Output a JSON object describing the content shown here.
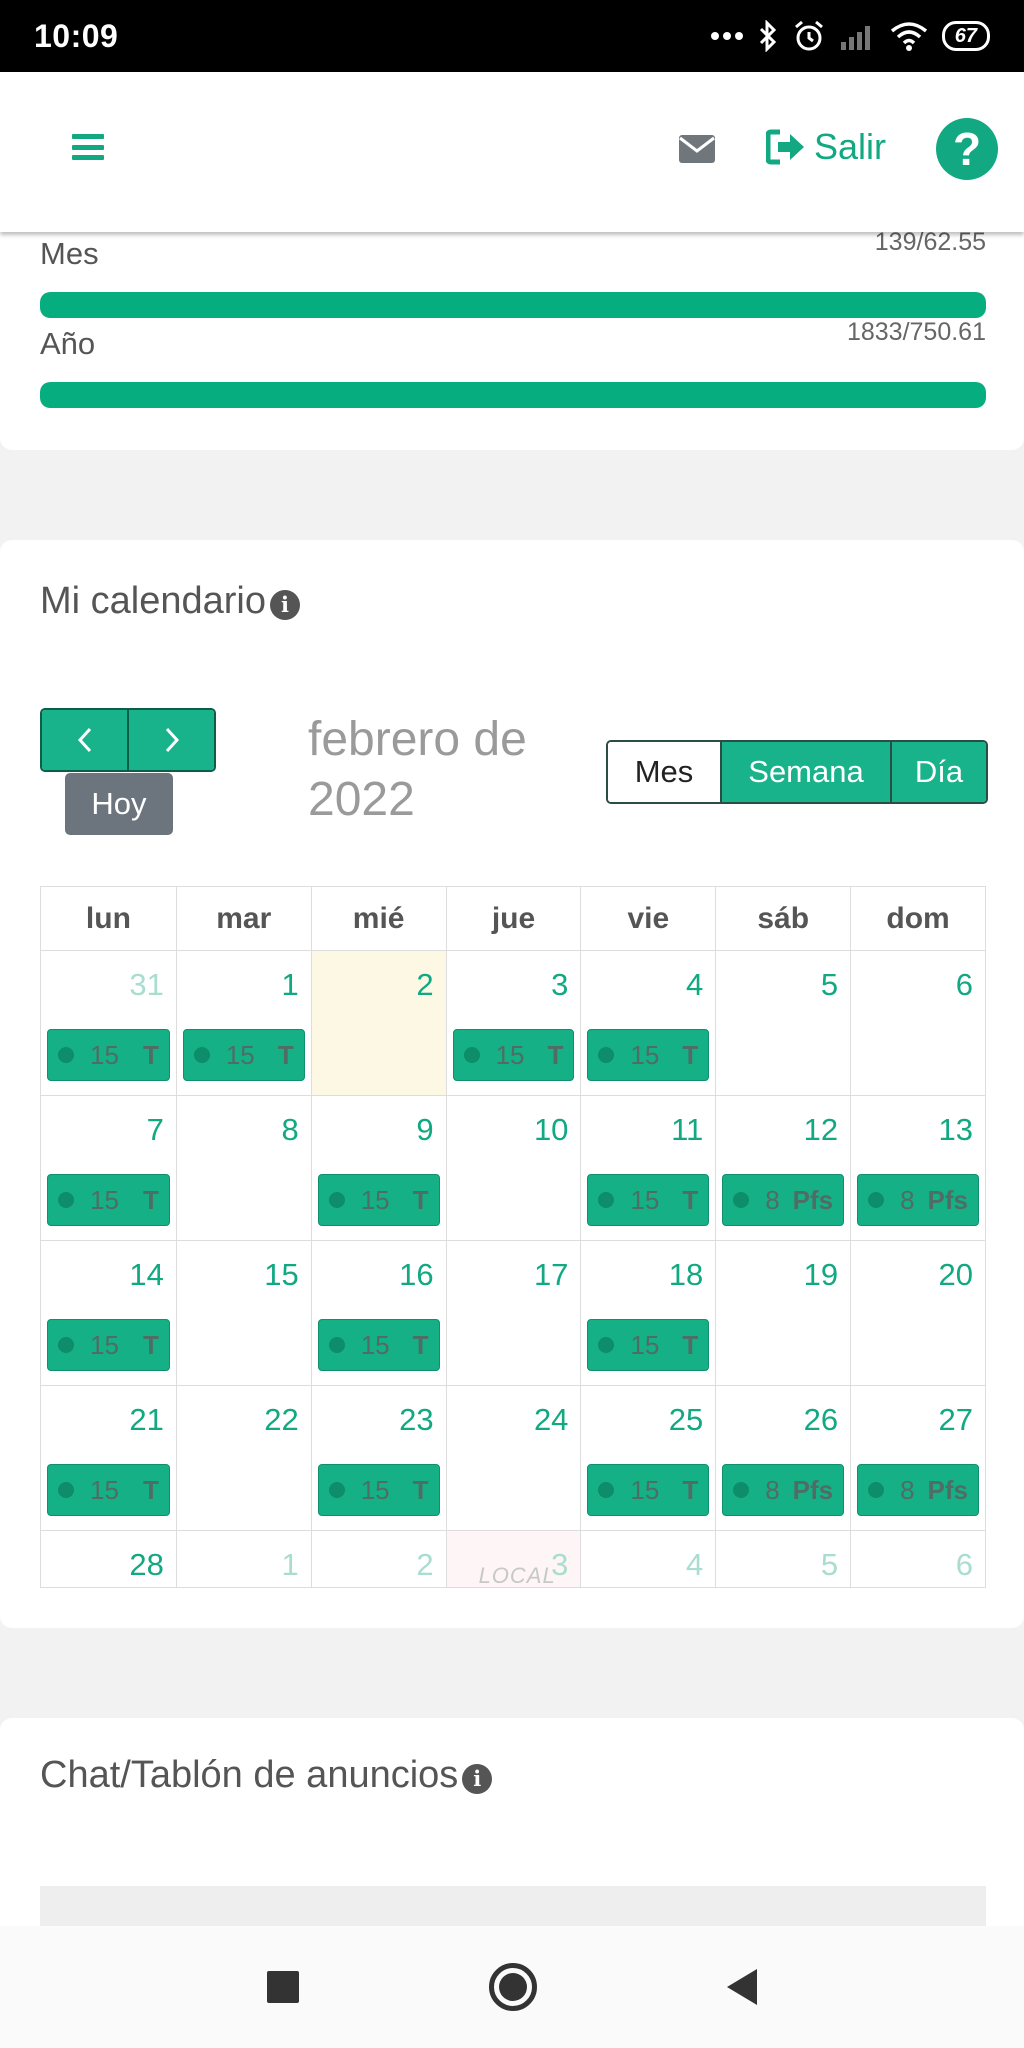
{
  "status_bar": {
    "time": "10:09",
    "battery": "67"
  },
  "header": {
    "logout_label": "Salir",
    "help_symbol": "?"
  },
  "stats": [
    {
      "label": "Mes",
      "value": "139/62.55",
      "progress": 1.0
    },
    {
      "label": "Año",
      "value": "1833/750.61",
      "progress": 1.0
    }
  ],
  "calendar": {
    "title": "Mi calendario",
    "info_symbol": "i",
    "prev_symbol": "‹",
    "next_symbol": "›",
    "today_label": "Hoy",
    "month_title": "febrero de 2022",
    "views": [
      "Mes",
      "Semana",
      "Día"
    ],
    "weekdays": [
      "lun",
      "mar",
      "mié",
      "jue",
      "vie",
      "sáb",
      "dom"
    ],
    "weeks": [
      [
        {
          "day": "31",
          "other": true,
          "event": {
            "num": "15",
            "code": "T"
          }
        },
        {
          "day": "1",
          "event": {
            "num": "15",
            "code": "T"
          }
        },
        {
          "day": "2",
          "today": true
        },
        {
          "day": "3",
          "event": {
            "num": "15",
            "code": "T"
          }
        },
        {
          "day": "4",
          "event": {
            "num": "15",
            "code": "T"
          }
        },
        {
          "day": "5"
        },
        {
          "day": "6"
        }
      ],
      [
        {
          "day": "7",
          "event": {
            "num": "15",
            "code": "T"
          }
        },
        {
          "day": "8"
        },
        {
          "day": "9",
          "event": {
            "num": "15",
            "code": "T"
          }
        },
        {
          "day": "10"
        },
        {
          "day": "11",
          "event": {
            "num": "15",
            "code": "T"
          }
        },
        {
          "day": "12",
          "event": {
            "num": "8",
            "code": "Pfs"
          }
        },
        {
          "day": "13",
          "event": {
            "num": "8",
            "code": "Pfs"
          }
        }
      ],
      [
        {
          "day": "14",
          "event": {
            "num": "15",
            "code": "T"
          }
        },
        {
          "day": "15"
        },
        {
          "day": "16",
          "event": {
            "num": "15",
            "code": "T"
          }
        },
        {
          "day": "17"
        },
        {
          "day": "18",
          "event": {
            "num": "15",
            "code": "T"
          }
        },
        {
          "day": "19"
        },
        {
          "day": "20"
        }
      ],
      [
        {
          "day": "21",
          "event": {
            "num": "15",
            "code": "T"
          }
        },
        {
          "day": "22"
        },
        {
          "day": "23",
          "event": {
            "num": "15",
            "code": "T"
          }
        },
        {
          "day": "24"
        },
        {
          "day": "25",
          "event": {
            "num": "15",
            "code": "T"
          }
        },
        {
          "day": "26",
          "event": {
            "num": "8",
            "code": "Pfs"
          }
        },
        {
          "day": "27",
          "event": {
            "num": "8",
            "code": "Pfs"
          }
        }
      ],
      [
        {
          "day": "28"
        },
        {
          "day": "1",
          "other": true
        },
        {
          "day": "2",
          "other": true
        },
        {
          "day": "3",
          "other": true,
          "local": "LOCAL"
        },
        {
          "day": "4",
          "other": true
        },
        {
          "day": "5",
          "other": true
        },
        {
          "day": "6",
          "other": true
        }
      ]
    ]
  },
  "chat": {
    "title": "Chat/Tablón de anuncios",
    "info_symbol": "i"
  },
  "colors": {
    "accent": "#12a882",
    "bar": "#06ad7f",
    "today": "#fcf8e3",
    "dark_button": "#6c757d"
  }
}
